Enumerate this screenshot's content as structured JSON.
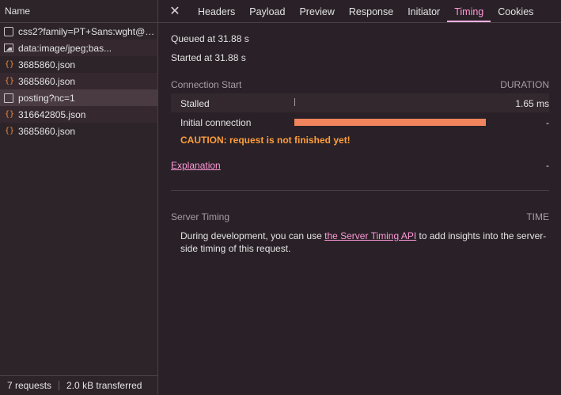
{
  "sidebar": {
    "header": "Name",
    "requests": [
      {
        "icon": "document-icon",
        "label": "css2?family=PT+Sans:wght@4..."
      },
      {
        "icon": "image-icon",
        "label": "data:image/jpeg;bas..."
      },
      {
        "icon": "json-icon",
        "label": "3685860.json"
      },
      {
        "icon": "json-icon",
        "label": "3685860.json"
      },
      {
        "icon": "post-icon",
        "label": "posting?nc=1"
      },
      {
        "icon": "json-icon",
        "label": "316642805.json"
      },
      {
        "icon": "json-icon",
        "label": "3685860.json"
      }
    ],
    "footer": {
      "requests": "7 requests",
      "transferred": "2.0 kB transferred"
    }
  },
  "tabs": [
    "Headers",
    "Payload",
    "Preview",
    "Response",
    "Initiator",
    "Timing",
    "Cookies"
  ],
  "active_tab": "Timing",
  "timing": {
    "queued": "Queued at 31.88 s",
    "started": "Started at 31.88 s",
    "connection_start": "Connection Start",
    "duration_label": "DURATION",
    "stalled_label": "Stalled",
    "stalled_value": "1.65 ms",
    "initial_connection_label": "Initial connection",
    "initial_connection_value": "-",
    "caution": "CAUTION: request is not finished yet!",
    "explanation": "Explanation",
    "explanation_value": "-",
    "server_timing": "Server Timing",
    "time_label": "TIME",
    "server_text_before": "During development, you can use ",
    "server_link": "the Server Timing API",
    "server_text_after": " to add insights into the server-side timing of this request."
  },
  "colors": {
    "accent": "#ff99d8",
    "bar": "#f0845c",
    "caution": "#ff9d3d",
    "json_icon": "#f08b3c"
  }
}
